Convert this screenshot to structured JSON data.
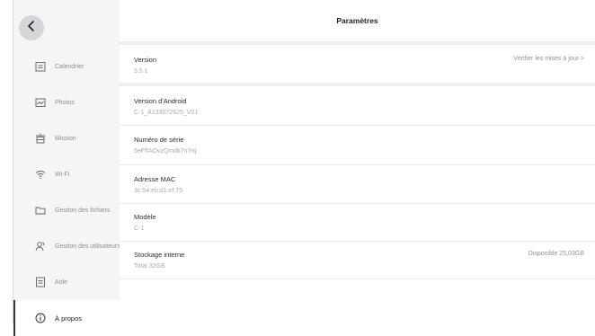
{
  "header": {
    "title": "Paramètres"
  },
  "sidebar": {
    "items": [
      {
        "label": "Calendrier",
        "icon": "calendar-icon"
      },
      {
        "label": "Photos",
        "icon": "photo-icon"
      },
      {
        "label": "Mission",
        "icon": "mission-icon"
      },
      {
        "label": "Wi-Fi",
        "icon": "wifi-icon"
      },
      {
        "label": "Gestion des fichiers",
        "icon": "folder-icon"
      },
      {
        "label": "Gestion des utilisateurs",
        "icon": "users-icon"
      },
      {
        "label": "Aide",
        "icon": "help-icon"
      },
      {
        "label": "À propos",
        "icon": "info-icon"
      }
    ]
  },
  "settings": {
    "version": {
      "label": "Version",
      "value": "3.5.1",
      "action": "Vérifier les mises à jour >"
    },
    "android": {
      "label": "Version d'Android",
      "value": "C-1_A133072625_V01"
    },
    "serial": {
      "label": "Numéro de série",
      "value": "6eFffAOvzQmdk7n7rq"
    },
    "mac": {
      "label": "Adresse MAC",
      "value": "3c:54:eb:d1:ef:75"
    },
    "model": {
      "label": "Modèle",
      "value": "C-1"
    },
    "storage": {
      "label": "Stockage interne",
      "value": "Total 32GB",
      "available": "Disponible 25,03GB"
    }
  },
  "colors": {
    "sidebar_bg": "#f4f5f7",
    "separator": "#eceef3",
    "active_indicator": "#3a3a3a"
  }
}
